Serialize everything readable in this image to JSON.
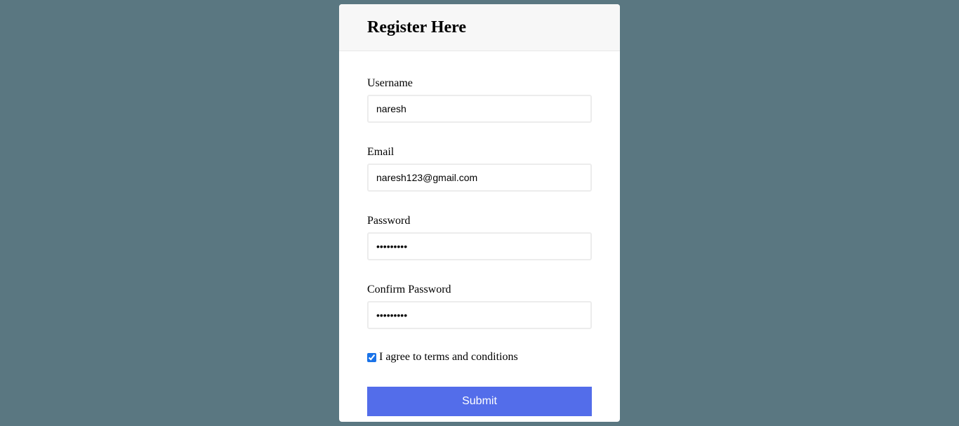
{
  "form": {
    "title": "Register Here",
    "username": {
      "label": "Username",
      "value": "naresh"
    },
    "email": {
      "label": "Email",
      "value": "naresh123@gmail.com"
    },
    "password": {
      "label": "Password",
      "value": "•••••••••"
    },
    "confirm_password": {
      "label": "Confirm Password",
      "value": "•••••••••"
    },
    "terms": {
      "label": "I agree to terms and conditions",
      "checked": true
    },
    "submit_label": "Submit"
  },
  "colors": {
    "background": "#5a7781",
    "card": "#ffffff",
    "header": "#f7f7f7",
    "button": "#536dea"
  }
}
